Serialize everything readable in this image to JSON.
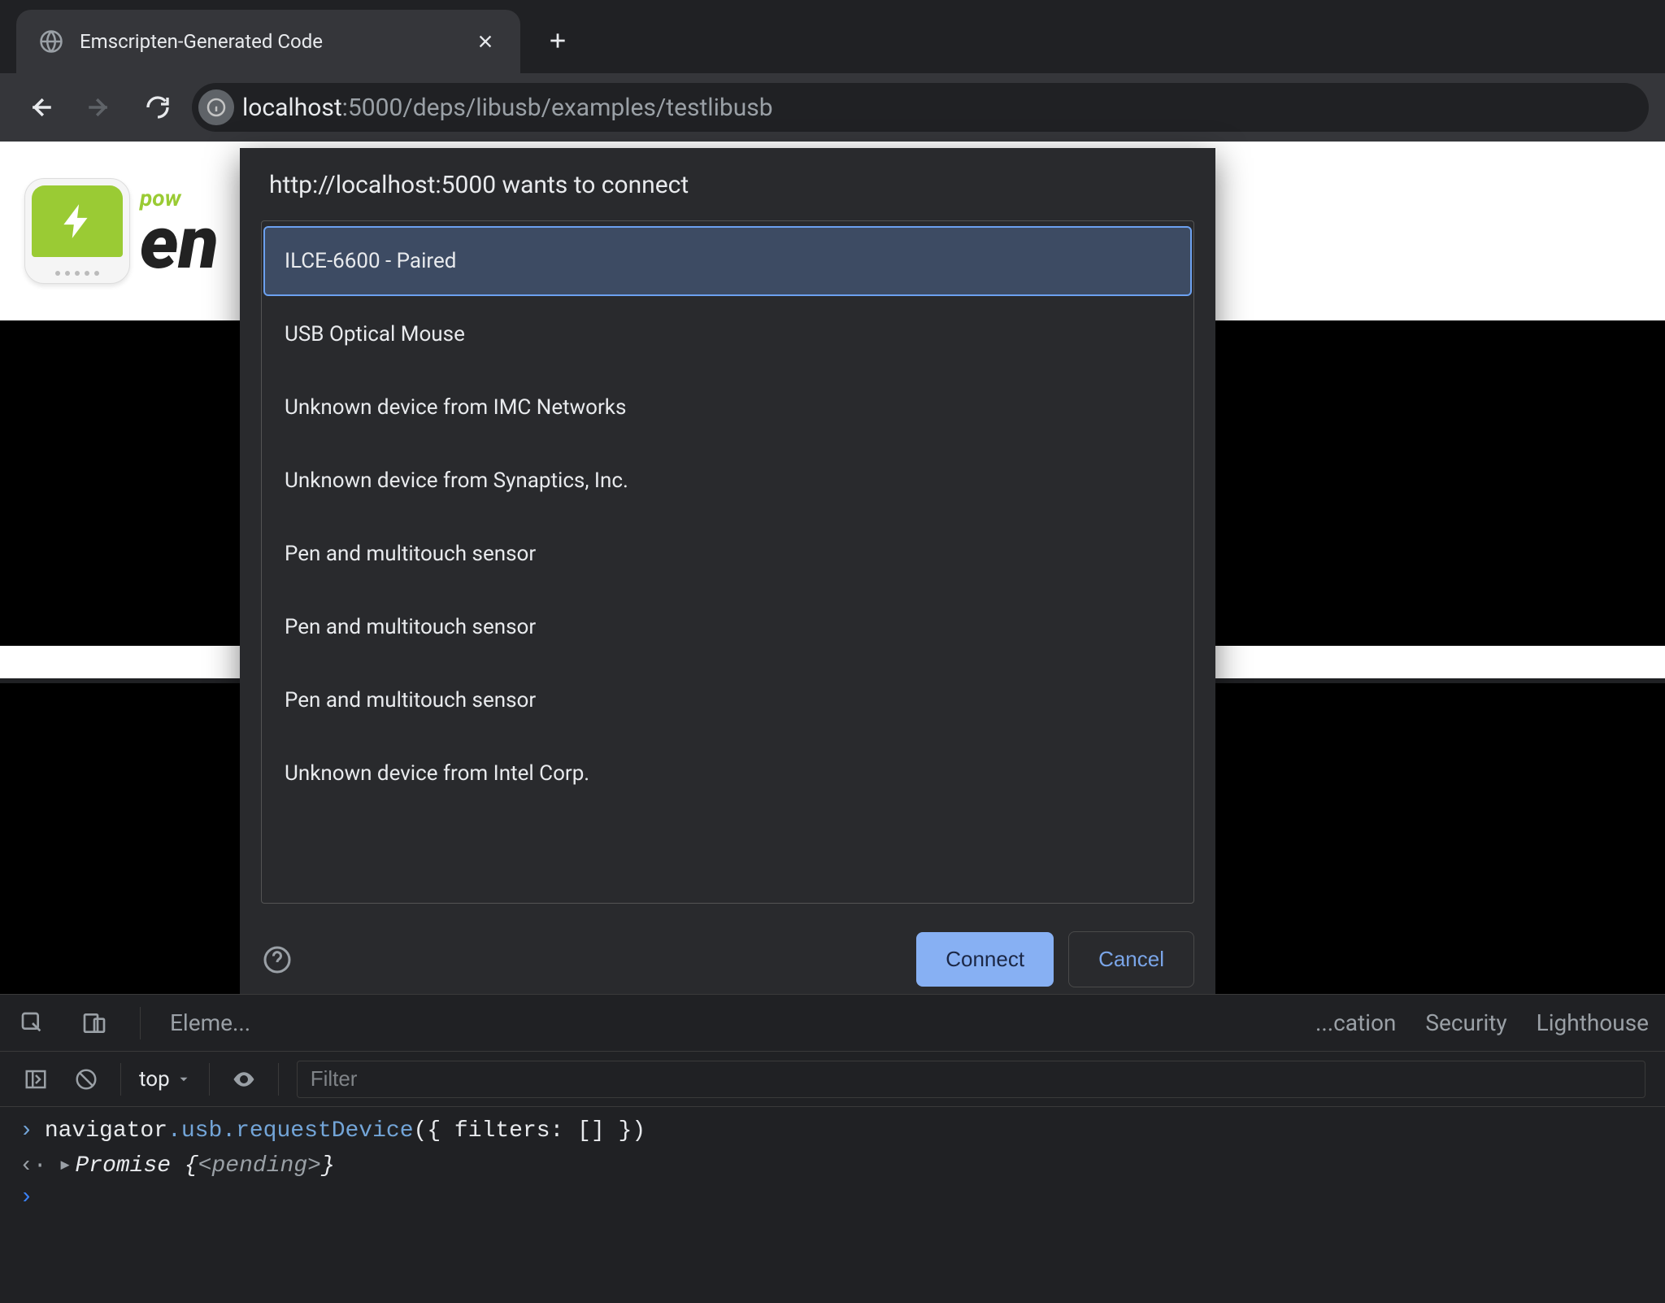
{
  "browser": {
    "tab_title": "Emscripten-Generated Code",
    "url_host": "localhost",
    "url_path": ":5000/deps/libusb/examples/testlibusb"
  },
  "page": {
    "logo_pow": "pow",
    "logo_en": "en"
  },
  "dialog": {
    "title": "http://localhost:5000 wants to connect",
    "devices": [
      "ILCE-6600 - Paired",
      "USB Optical Mouse",
      "Unknown device from IMC Networks",
      "Unknown device from Synaptics, Inc.",
      "Pen and multitouch sensor",
      "Pen and multitouch sensor",
      "Pen and multitouch sensor",
      "Unknown device from Intel Corp."
    ],
    "connect": "Connect",
    "cancel": "Cancel"
  },
  "devtools": {
    "tabs": {
      "elements": "Eleme...",
      "application_tail": "...cation",
      "security": "Security",
      "lighthouse": "Lighthouse"
    },
    "context": "top",
    "filter_placeholder": "Filter",
    "console": {
      "line1_prefix": "navigator",
      "line1_usb": ".usb",
      "line1_method": ".requestDevice",
      "line1_args": "({ filters: [] })",
      "line2_promise": "Promise",
      "line2_brace_open": " {",
      "line2_pending": "<pending>",
      "line2_brace_close": "}"
    }
  }
}
